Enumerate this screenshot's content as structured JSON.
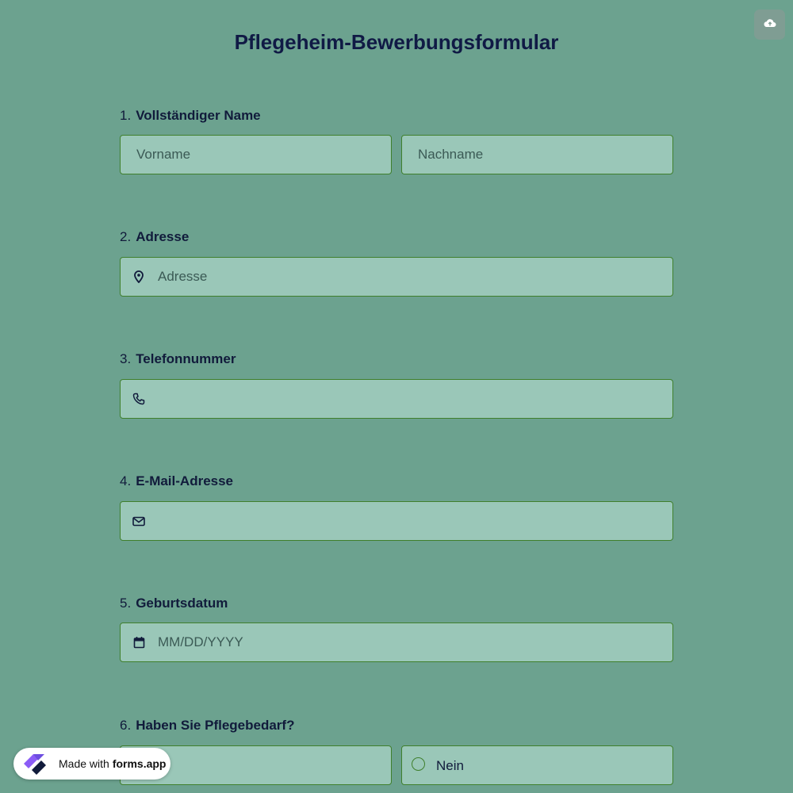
{
  "form": {
    "title": "Pflegeheim-Bewerbungsformular",
    "save_icon": "cloud-upload-icon"
  },
  "questions": [
    {
      "number": "1.",
      "label": "Vollständiger Name",
      "fields": [
        {
          "placeholder": "Vorname"
        },
        {
          "placeholder": "Nachname"
        }
      ]
    },
    {
      "number": "2.",
      "label": "Adresse",
      "icon": "location-pin-icon",
      "placeholder": "Adresse"
    },
    {
      "number": "3.",
      "label": "Telefonnummer",
      "icon": "phone-icon",
      "placeholder": ""
    },
    {
      "number": "4.",
      "label": "E-Mail-Adresse",
      "icon": "envelope-icon",
      "placeholder": ""
    },
    {
      "number": "5.",
      "label": "Geburtsdatum",
      "icon": "calendar-icon",
      "placeholder": "MM/DD/YYYY"
    },
    {
      "number": "6.",
      "label": "Haben Sie Pflegebedarf?",
      "options": [
        "",
        "Nein"
      ]
    }
  ],
  "badge": {
    "made_with": "Made with",
    "brand": "forms.app"
  },
  "colors": {
    "background": "#6ca28f",
    "field_background": "#9ac7b8",
    "field_border": "#3f7f2c",
    "title": "#101a45"
  }
}
